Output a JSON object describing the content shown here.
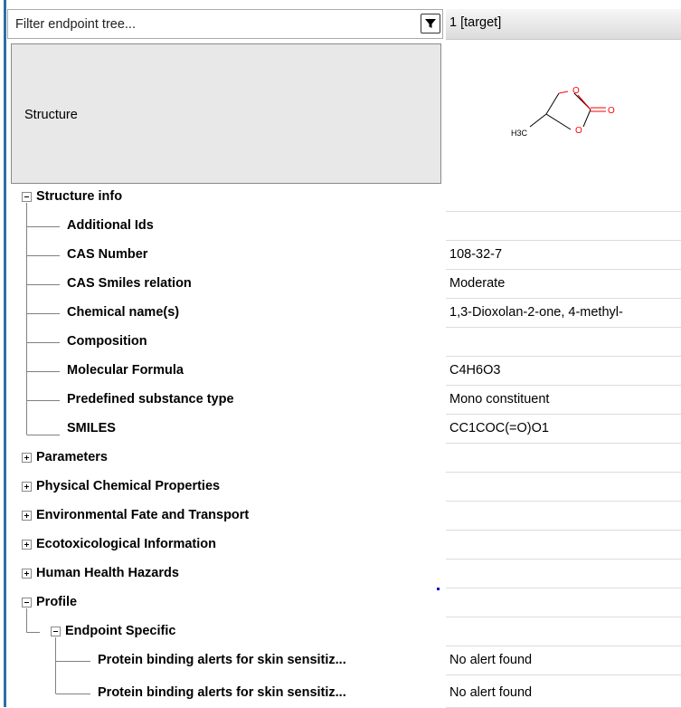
{
  "filter": {
    "placeholder": "Filter endpoint tree..."
  },
  "header": {
    "column_label": "1 [target]"
  },
  "structure": {
    "label": "Structure",
    "atom_labels": {
      "o1": "O",
      "o2": "O",
      "o3": "O",
      "methyl": "H3C"
    }
  },
  "rows": [
    {
      "label": "Structure info",
      "value": ""
    },
    {
      "label": "Additional Ids",
      "value": ""
    },
    {
      "label": "CAS Number",
      "value": "108-32-7"
    },
    {
      "label": "CAS Smiles relation",
      "value": "Moderate"
    },
    {
      "label": "Chemical name(s)",
      "value": "1,3-Dioxolan-2-one, 4-methyl-"
    },
    {
      "label": "Composition",
      "value": ""
    },
    {
      "label": "Molecular Formula",
      "value": "C4H6O3"
    },
    {
      "label": "Predefined substance type",
      "value": "Mono constituent"
    },
    {
      "label": "SMILES",
      "value": "CC1COC(=O)O1"
    },
    {
      "label": "Parameters",
      "value": ""
    },
    {
      "label": "Physical Chemical Properties",
      "value": ""
    },
    {
      "label": "Environmental Fate and Transport",
      "value": ""
    },
    {
      "label": "Ecotoxicological Information",
      "value": ""
    },
    {
      "label": "Human Health Hazards",
      "value": ""
    },
    {
      "label": "Profile",
      "value": ""
    },
    {
      "label": "Endpoint Specific",
      "value": ""
    },
    {
      "label": "Protein binding alerts for skin sensitiz...",
      "value": "No alert found"
    },
    {
      "label": "Protein binding alerts for skin sensitiz...",
      "value": "No alert found"
    }
  ],
  "colors": {
    "accent": "#2c6fa5",
    "oxygen": "#ff0000"
  }
}
